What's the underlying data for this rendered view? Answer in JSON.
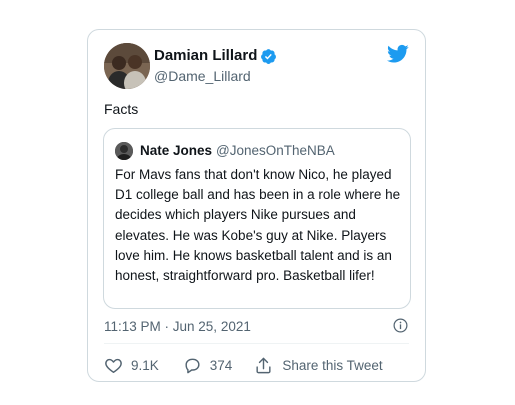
{
  "tweet": {
    "author": {
      "name": "Damian Lillard",
      "handle": "@Dame_Lillard"
    },
    "text": "Facts",
    "quoted": {
      "author_name": "Nate Jones",
      "author_handle": "@JonesOnTheNBA",
      "text": "For Mavs fans that don't know Nico, he played D1 college ball and has been in a role where he decides which players Nike pursues and elevates. He was Kobe's guy at Nike. Players love him. He knows basketball talent and is an honest, straightforward pro. Basketball lifer!"
    },
    "timestamp": "11:13 PM · Jun 25, 2021",
    "actions": {
      "like_count": "9.1K",
      "reply_count": "374",
      "share_label": "Share this Tweet"
    }
  },
  "colors": {
    "twitter_blue": "#1d9bf0",
    "text_primary": "#0f1419",
    "text_secondary": "#536471",
    "border": "#cfd9de"
  },
  "icons": {
    "logo": "twitter-bird-icon",
    "verified": "verified-badge-icon",
    "info": "info-icon",
    "like": "heart-icon",
    "reply": "speech-bubble-icon",
    "share": "share-upload-icon"
  }
}
